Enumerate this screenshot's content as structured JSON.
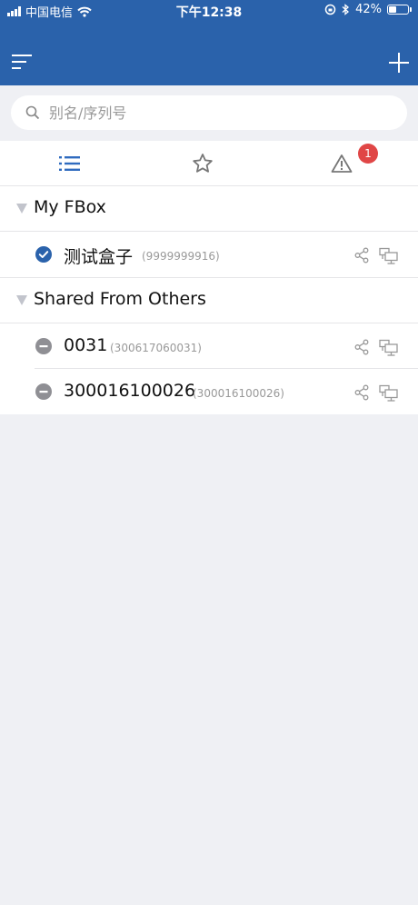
{
  "status_bar": {
    "carrier": "中国电信",
    "time": "下午12:38",
    "battery": "42%",
    "battery_level": 0.42,
    "icons": [
      "signal-icon",
      "wifi-icon",
      "orientation-lock-icon",
      "bluetooth-icon",
      "battery-icon"
    ]
  },
  "header": {
    "menu_icon": "menu-icon",
    "add_icon": "plus-icon",
    "background": "#2a62ab"
  },
  "search": {
    "placeholder": "别名/序列号",
    "value": "",
    "icon": "search-icon"
  },
  "tabs": [
    {
      "icon": "list-icon",
      "active": true
    },
    {
      "icon": "star-icon",
      "active": false
    },
    {
      "icon": "alert-icon",
      "active": false,
      "badge": "1"
    }
  ],
  "groups": [
    {
      "title": "My FBox",
      "items": [
        {
          "name": "测试盒子",
          "serial": "(9999999916)",
          "status": "online-check-icon"
        }
      ]
    },
    {
      "title": "Shared From Others",
      "items": [
        {
          "name": "0031",
          "serial": "(300617060031)",
          "status": "offline-minus-icon"
        },
        {
          "name": "300016100026",
          "serial": "(300016100026)",
          "status": "offline-minus-icon"
        }
      ]
    }
  ],
  "colors": {
    "accent": "#2a62ab",
    "badge": "#e04646",
    "online": "#2a62ab",
    "offline": "#8f8f94",
    "icon_gray": "#999999"
  }
}
